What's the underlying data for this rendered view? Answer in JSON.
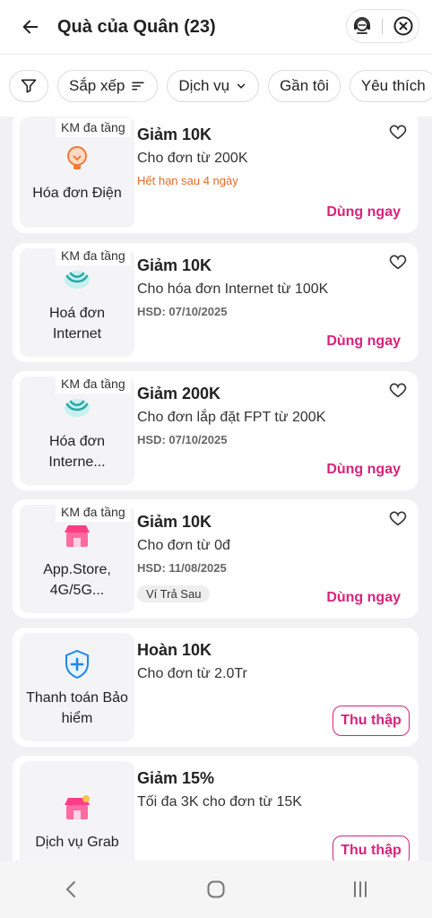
{
  "header": {
    "title": "Quà của Quân (23)"
  },
  "filters": [
    {
      "label": "Sắp xếp"
    },
    {
      "label": "Dịch vụ"
    },
    {
      "label": "Gần tôi"
    },
    {
      "label": "Yêu thích"
    }
  ],
  "vouchers": [
    {
      "km_tag": "KM đa tầng",
      "category": "Hóa đơn Điện",
      "title": "Giảm 10K",
      "desc": "Cho đơn từ 200K",
      "expiry": "Hết hạn sau 4 ngày",
      "action": "Dùng ngay"
    },
    {
      "km_tag": "KM đa tầng",
      "category": "Hoá đơn Internet",
      "title": "Giảm 10K",
      "desc": "Cho hóa đơn Internet từ 100K",
      "expiry": "HSD: 07/10/2025",
      "action": "Dùng ngay"
    },
    {
      "km_tag": "KM đa tầng",
      "category": "Hóa đơn Interne...",
      "title": "Giảm 200K",
      "desc": "Cho đơn lắp đặt FPT từ 200K",
      "expiry": "HSD: 07/10/2025",
      "action": "Dùng ngay"
    },
    {
      "km_tag": "KM đa tầng",
      "category": "App.Store, 4G/5G...",
      "title": "Giảm 10K",
      "desc": "Cho đơn từ 0đ",
      "expiry": "HSD: 11/08/2025",
      "badge": "Ví Trả Sau",
      "action": "Dùng ngay"
    },
    {
      "category": "Thanh toán Bảo hiểm",
      "title": "Hoàn 10K",
      "desc": "Cho đơn từ 2.0Tr",
      "action": "Thu thập"
    },
    {
      "category": "Dịch vụ Grab",
      "title": "Giảm 15%",
      "desc": "Tối đa 3K cho đơn từ 15K",
      "action": "Thu thập"
    }
  ],
  "colors": {
    "accent": "#d8237c",
    "warning": "#e86a25"
  }
}
